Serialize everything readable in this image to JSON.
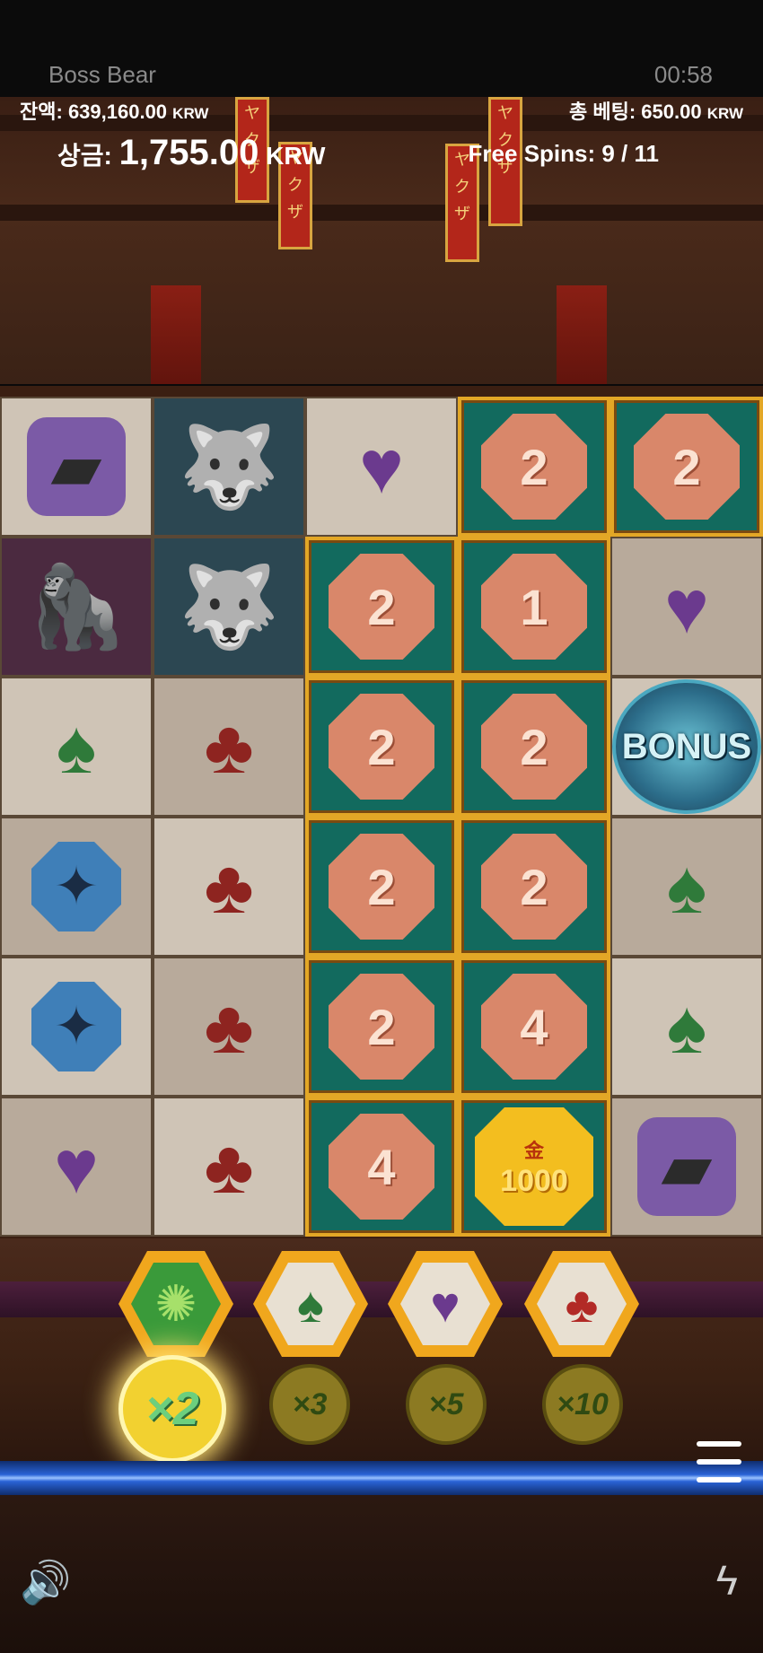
{
  "header": {
    "game_title": "Boss Bear",
    "clock": "00:58",
    "balance_label": "잔액:",
    "balance_value": "639,160.00",
    "currency": "KRW",
    "bet_label": "총 베팅:",
    "bet_value": "650.00",
    "win_label": "상금:",
    "win_value": "1,755.00",
    "free_spins_label": "Free Spins:",
    "free_spins_value": "9 / 11"
  },
  "banners": [
    "ヤクザ",
    "ヤクザ",
    "ヤクザ",
    "ヤクザ"
  ],
  "grid": {
    "rows": [
      [
        {
          "type": "gun"
        },
        {
          "type": "wolf"
        },
        {
          "type": "heart"
        },
        {
          "type": "coin",
          "value": "2"
        },
        {
          "type": "coin",
          "value": "2"
        }
      ],
      [
        {
          "type": "ape"
        },
        {
          "type": "wolf"
        },
        {
          "type": "coin",
          "value": "2"
        },
        {
          "type": "coin",
          "value": "1"
        },
        {
          "type": "heart"
        }
      ],
      [
        {
          "type": "spade"
        },
        {
          "type": "club"
        },
        {
          "type": "coin",
          "value": "2"
        },
        {
          "type": "coin",
          "value": "2"
        },
        {
          "type": "bonus",
          "label": "BONUS"
        }
      ],
      [
        {
          "type": "shuriken"
        },
        {
          "type": "club"
        },
        {
          "type": "coin",
          "value": "2"
        },
        {
          "type": "coin",
          "value": "2"
        },
        {
          "type": "spade"
        }
      ],
      [
        {
          "type": "shuriken"
        },
        {
          "type": "club"
        },
        {
          "type": "coin",
          "value": "2"
        },
        {
          "type": "coin",
          "value": "4"
        },
        {
          "type": "spade"
        }
      ],
      [
        {
          "type": "heart"
        },
        {
          "type": "club"
        },
        {
          "type": "coin",
          "value": "4"
        },
        {
          "type": "gold",
          "kanji": "金",
          "value": "1000"
        },
        {
          "type": "gun"
        }
      ]
    ]
  },
  "tray": {
    "symbols": [
      {
        "name": "green-orb",
        "glyph": "✺"
      },
      {
        "name": "spade",
        "glyph": "♠"
      },
      {
        "name": "heart",
        "glyph": "♥"
      },
      {
        "name": "club",
        "glyph": "♣"
      }
    ],
    "multipliers": [
      {
        "label": "×2",
        "active": true
      },
      {
        "label": "×3",
        "active": false
      },
      {
        "label": "×5",
        "active": false
      },
      {
        "label": "×10",
        "active": false
      }
    ]
  },
  "controls": {
    "menu_icon": "hamburger-menu-icon",
    "sound_icon": "speaker-icon",
    "turbo_icon": "lightning-icon"
  },
  "colors": {
    "highlight_border": "#e3a726",
    "coin": "#d9876a",
    "gold_coin": "#f3be1f",
    "rail_blue": "#2a63d6"
  }
}
